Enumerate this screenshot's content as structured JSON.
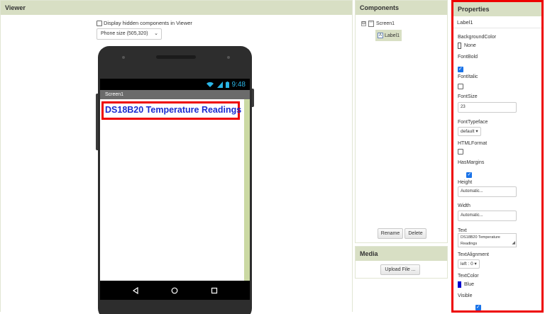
{
  "viewer": {
    "header": "Viewer",
    "hidden_components_label": "Display hidden components in Viewer",
    "phone_size": "Phone size (505,320)",
    "status_time": "9:48",
    "screen_title": "Screen1",
    "label_text": "DS18B20 Temperature Readings",
    "label_color": "#1a2bd1"
  },
  "components": {
    "header": "Components",
    "tree": [
      {
        "name": "Screen1",
        "toggle": "⊟"
      },
      {
        "name": "Label1",
        "icon": "A"
      }
    ],
    "rename_label": "Rename",
    "delete_label": "Delete"
  },
  "media": {
    "header": "Media",
    "upload_label": "Upload File ..."
  },
  "properties": {
    "header": "Properties",
    "selected": "Label1",
    "background_color": {
      "label": "BackgroundColor",
      "value": "None"
    },
    "font_bold": {
      "label": "FontBold",
      "checked": true
    },
    "font_italic": {
      "label": "FontItalic",
      "checked": false
    },
    "font_size": {
      "label": "FontSize",
      "value": "23"
    },
    "font_typeface": {
      "label": "FontTypeface",
      "value": "default"
    },
    "html_format": {
      "label": "HTMLFormat",
      "checked": false
    },
    "has_margins": {
      "label": "HasMargins",
      "checked": true
    },
    "height": {
      "label": "Height",
      "value": "Automatic..."
    },
    "width": {
      "label": "Width",
      "value": "Automatic..."
    },
    "text": {
      "label": "Text",
      "line1": "DS18B20 Temperature",
      "line2": "Readings"
    },
    "text_alignment": {
      "label": "TextAlignment",
      "value": "left : 0"
    },
    "text_color": {
      "label": "TextColor",
      "value": "Blue",
      "swatch": "#0000cc"
    },
    "visible": {
      "label": "Visible",
      "checked": true
    }
  },
  "colors": {
    "header_bg": "#d8dfc4",
    "highlight": "#e00000",
    "status_icon": "#2ab5e6"
  }
}
